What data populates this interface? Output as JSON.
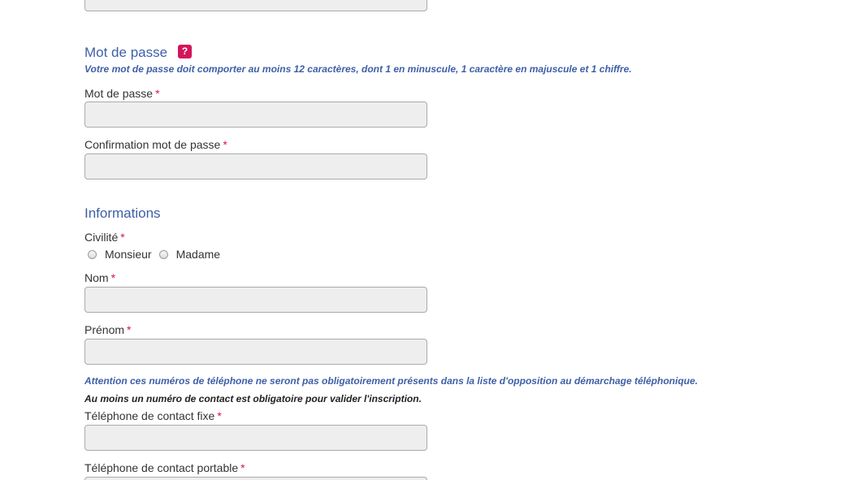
{
  "password_section": {
    "title": "Mot de passe",
    "help_badge": "?",
    "hint": "Votre mot de passe doit comporter au moins 12 caractères, dont 1 en minuscule, 1 caractère en majuscule et 1 chiffre.",
    "fields": {
      "password": {
        "label": "Mot de passe",
        "required_mark": "*",
        "value": ""
      },
      "confirm": {
        "label": "Confirmation mot de passe",
        "required_mark": "*",
        "value": ""
      }
    }
  },
  "info_section": {
    "title": "Informations",
    "civility": {
      "label": "Civilité",
      "required_mark": "*",
      "options": [
        "Monsieur",
        "Madame"
      ]
    },
    "fields": {
      "last_name": {
        "label": "Nom",
        "required_mark": "*",
        "value": ""
      },
      "first_name": {
        "label": "Prénom",
        "required_mark": "*",
        "value": ""
      },
      "phone_fixed": {
        "label": "Téléphone de contact fixe",
        "required_mark": "*",
        "value": ""
      },
      "phone_mobile": {
        "label": "Téléphone de contact portable",
        "required_mark": "*",
        "value": ""
      }
    },
    "phone_notice": "Attention ces numéros de téléphone ne seront pas obligatoirement présents dans la liste d'opposition au démarchage téléphonique.",
    "phone_required_notice": "Au moins un numéro de contact est obligatoire pour valider l'inscription."
  }
}
